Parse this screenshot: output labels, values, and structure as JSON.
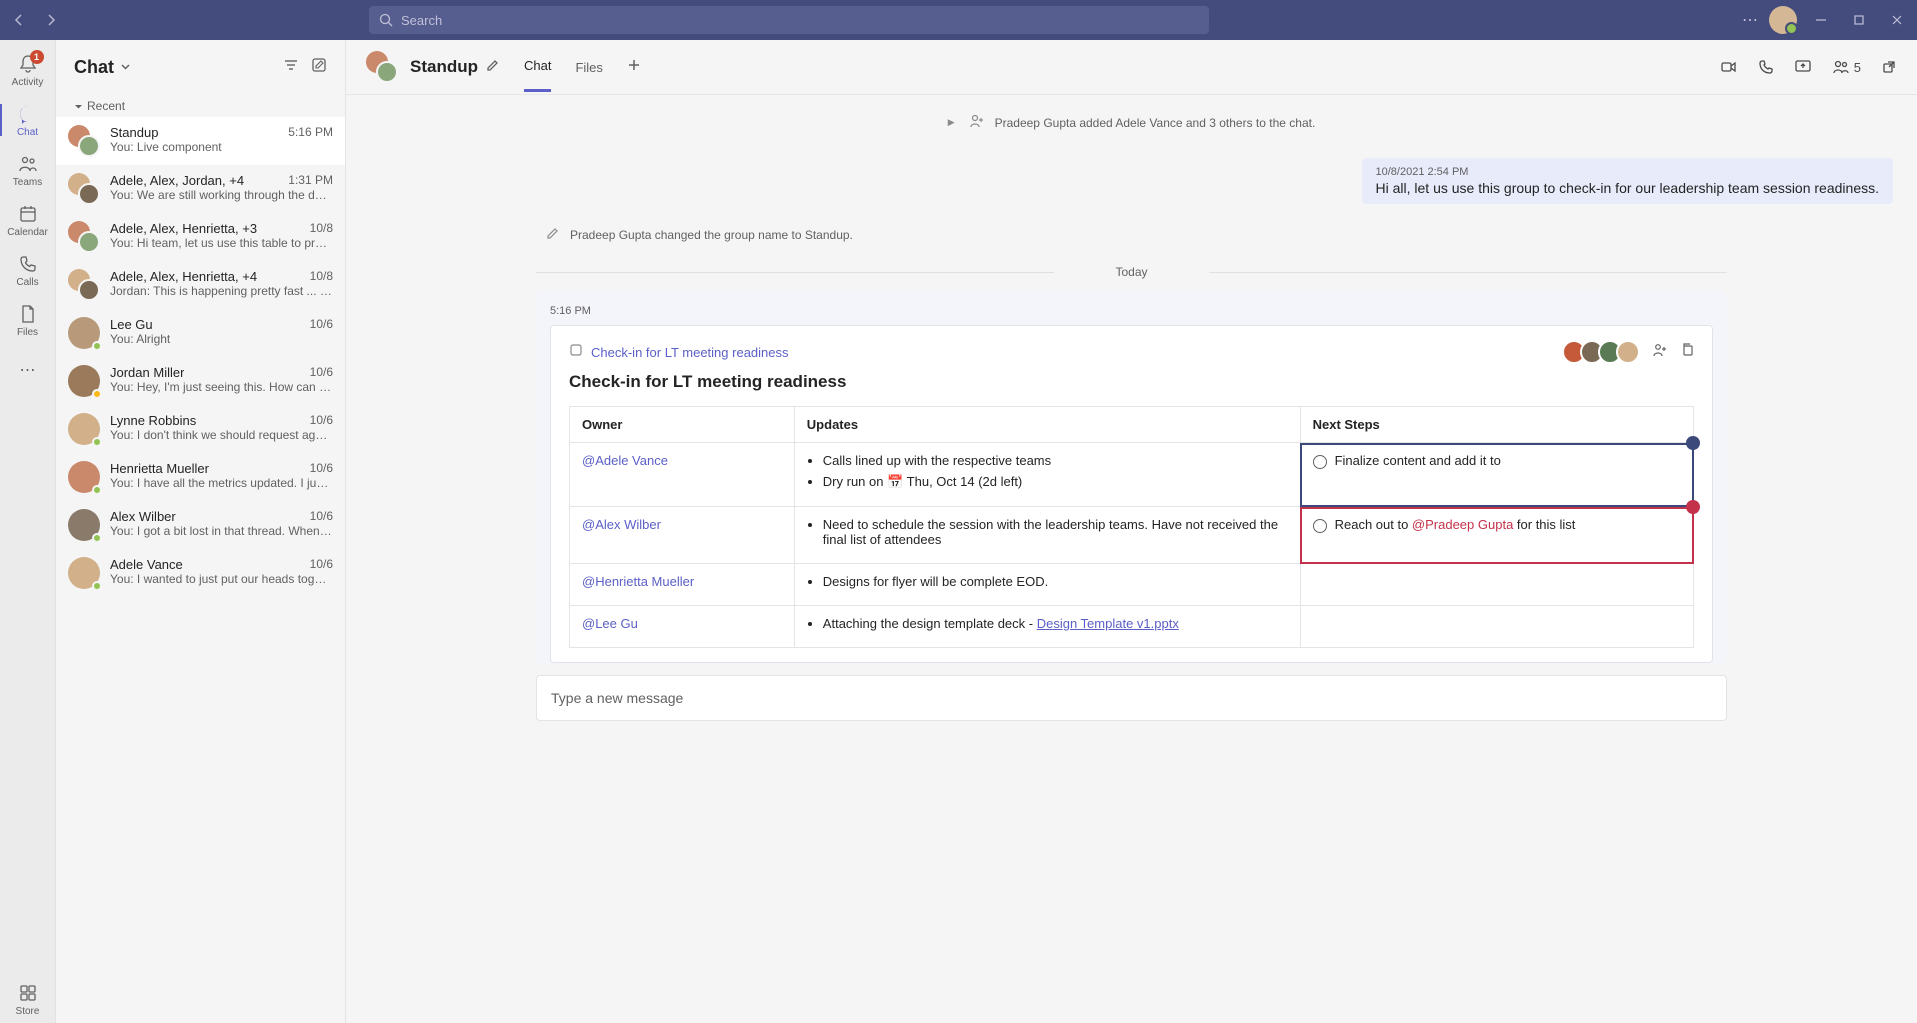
{
  "titlebar": {
    "search_placeholder": "Search"
  },
  "rail": {
    "activity": "Activity",
    "chat": "Chat",
    "teams": "Teams",
    "calendar": "Calendar",
    "calls": "Calls",
    "files": "Files",
    "store": "Store",
    "activity_badge": "1"
  },
  "chatlist": {
    "title": "Chat",
    "recent": "Recent",
    "items": [
      {
        "name": "Standup",
        "time": "5:16 PM",
        "preview": "You: Live component",
        "pair": true
      },
      {
        "name": "Adele, Alex, Jordan, +4",
        "time": "1:31 PM",
        "preview": "You: We are still working through the details, b...",
        "pair": true
      },
      {
        "name": "Adele, Alex, Henrietta, +3",
        "time": "10/8",
        "preview": "You: Hi team, let us use this table to provide upd...",
        "pair": true
      },
      {
        "name": "Adele, Alex, Henrietta, +4",
        "time": "10/8",
        "preview": "Jordan: This is happening pretty fast ... can some...",
        "pair": true
      },
      {
        "name": "Lee Gu",
        "time": "10/6",
        "preview": "You: Alright",
        "pair": false,
        "presence": "online"
      },
      {
        "name": "Jordan Miller",
        "time": "10/6",
        "preview": "You: Hey, I'm just seeing this. How can I help? W...",
        "pair": false,
        "presence": "away"
      },
      {
        "name": "Lynne Robbins",
        "time": "10/6",
        "preview": "You: I don't think we should request agency bud...",
        "pair": false,
        "presence": "online"
      },
      {
        "name": "Henrietta Mueller",
        "time": "10/6",
        "preview": "You: I have all the metrics updated. I just need th...",
        "pair": false,
        "presence": "online"
      },
      {
        "name": "Alex Wilber",
        "time": "10/6",
        "preview": "You: I got a bit lost in that thread. When is this pr...",
        "pair": false,
        "presence": "online"
      },
      {
        "name": "Adele Vance",
        "time": "10/6",
        "preview": "You: I wanted to just put our heads together and...",
        "pair": false,
        "presence": "online"
      }
    ]
  },
  "main": {
    "title": "Standup",
    "tabs": {
      "chat": "Chat",
      "files": "Files"
    },
    "participants_count": "5",
    "system_added": "Pradeep Gupta added Adele Vance and 3 others to the chat.",
    "msg_stamp": "10/8/2021 2:54 PM",
    "msg_text": "Hi all, let us use this group to check-in for our leadership team session readiness.",
    "system_renamed": "Pradeep Gupta changed the group name to Standup.",
    "today": "Today",
    "card": {
      "time": "5:16 PM",
      "link": "Check-in for LT meeting readiness",
      "title": "Check-in for LT meeting readiness",
      "cols": {
        "owner": "Owner",
        "updates": "Updates",
        "next": "Next Steps"
      },
      "rows": [
        {
          "owner": "@Adele Vance",
          "updates": [
            "Calls lined up with the respective teams",
            "Dry run on 📅 Thu, Oct 14 (2d left)"
          ],
          "next": "Finalize content and add it to",
          "next_mention": ""
        },
        {
          "owner": "@Alex Wilber",
          "updates": [
            "Need to schedule the session with the leadership teams. Have not received the final list of attendees"
          ],
          "next": "Reach out to ",
          "next_mention": "@Pradeep Gupta",
          "next_tail": " for this list"
        },
        {
          "owner": "@Henrietta Mueller",
          "updates": [
            "Designs for flyer will be complete EOD."
          ],
          "next": ""
        },
        {
          "owner": "@Lee Gu",
          "updates_prefix": "Attaching the design template deck - ",
          "updates_link": "Design Template v1.pptx",
          "next": ""
        }
      ]
    },
    "compose_placeholder": "Type a new message"
  }
}
